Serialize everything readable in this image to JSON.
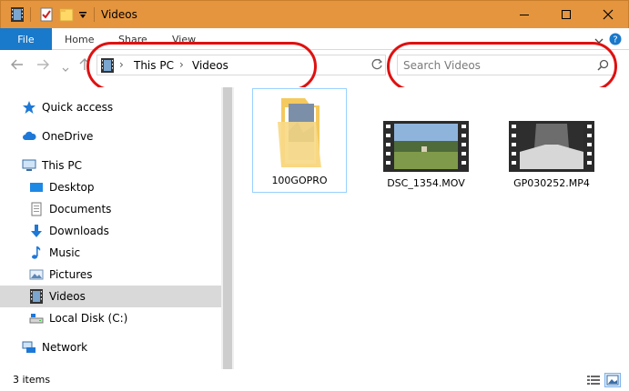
{
  "window": {
    "title": "Videos"
  },
  "ribbon": {
    "file": "File",
    "home": "Home",
    "share": "Share",
    "view": "View"
  },
  "address": {
    "crumbs": [
      "This PC",
      "Videos"
    ]
  },
  "search": {
    "placeholder": "Search Videos"
  },
  "sidebar": {
    "items": [
      {
        "label": "Quick access",
        "icon": "star-icon"
      },
      {
        "label": "OneDrive",
        "icon": "cloud-icon"
      },
      {
        "label": "This PC",
        "icon": "computer-icon"
      },
      {
        "label": "Desktop",
        "icon": "desktop-folder-icon"
      },
      {
        "label": "Documents",
        "icon": "documents-folder-icon"
      },
      {
        "label": "Downloads",
        "icon": "download-arrow-icon"
      },
      {
        "label": "Music",
        "icon": "music-note-icon"
      },
      {
        "label": "Pictures",
        "icon": "pictures-folder-icon"
      },
      {
        "label": "Videos",
        "icon": "film-icon"
      },
      {
        "label": "Local Disk (C:)",
        "icon": "drive-icon"
      },
      {
        "label": "Network",
        "icon": "network-icon"
      }
    ],
    "selected": "Videos"
  },
  "files": [
    {
      "name": "100GOPRO",
      "type": "folder"
    },
    {
      "name": "DSC_1354.MOV",
      "type": "video"
    },
    {
      "name": "GP030252.MP4",
      "type": "video"
    }
  ],
  "status": {
    "count": "3 items"
  },
  "colors": {
    "titlebar": "#e5953d",
    "file_tab": "#1979ca",
    "annotation": "#e01010",
    "selection": "#d9d9d9"
  }
}
